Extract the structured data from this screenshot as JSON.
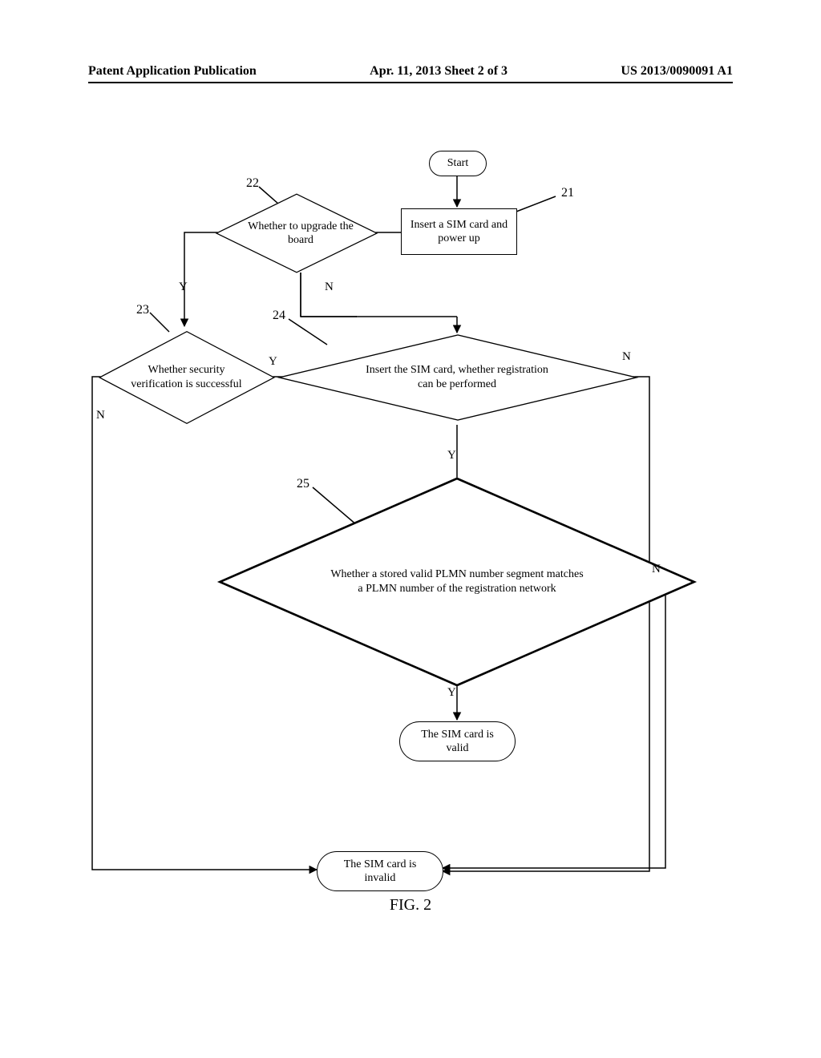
{
  "header": {
    "left": "Patent Application Publication",
    "center": "Apr. 11, 2013  Sheet 2 of 3",
    "right": "US 2013/0090091 A1"
  },
  "refs": {
    "r21": "21",
    "r22": "22",
    "r23": "23",
    "r24": "24",
    "r25": "25"
  },
  "nodes": {
    "start": "Start",
    "n21": "Insert a SIM card and power up",
    "n22": "Whether to upgrade the board",
    "n23": "Whether security verification is successful",
    "n24": "Insert the SIM card, whether registration can be performed",
    "n25": "Whether a stored valid PLMN number segment matches a PLMN number of the registration network",
    "valid": "The SIM card is valid",
    "invalid": "The SIM card is invalid"
  },
  "edges": {
    "y": "Y",
    "n": "N"
  },
  "fig": "FIG. 2"
}
